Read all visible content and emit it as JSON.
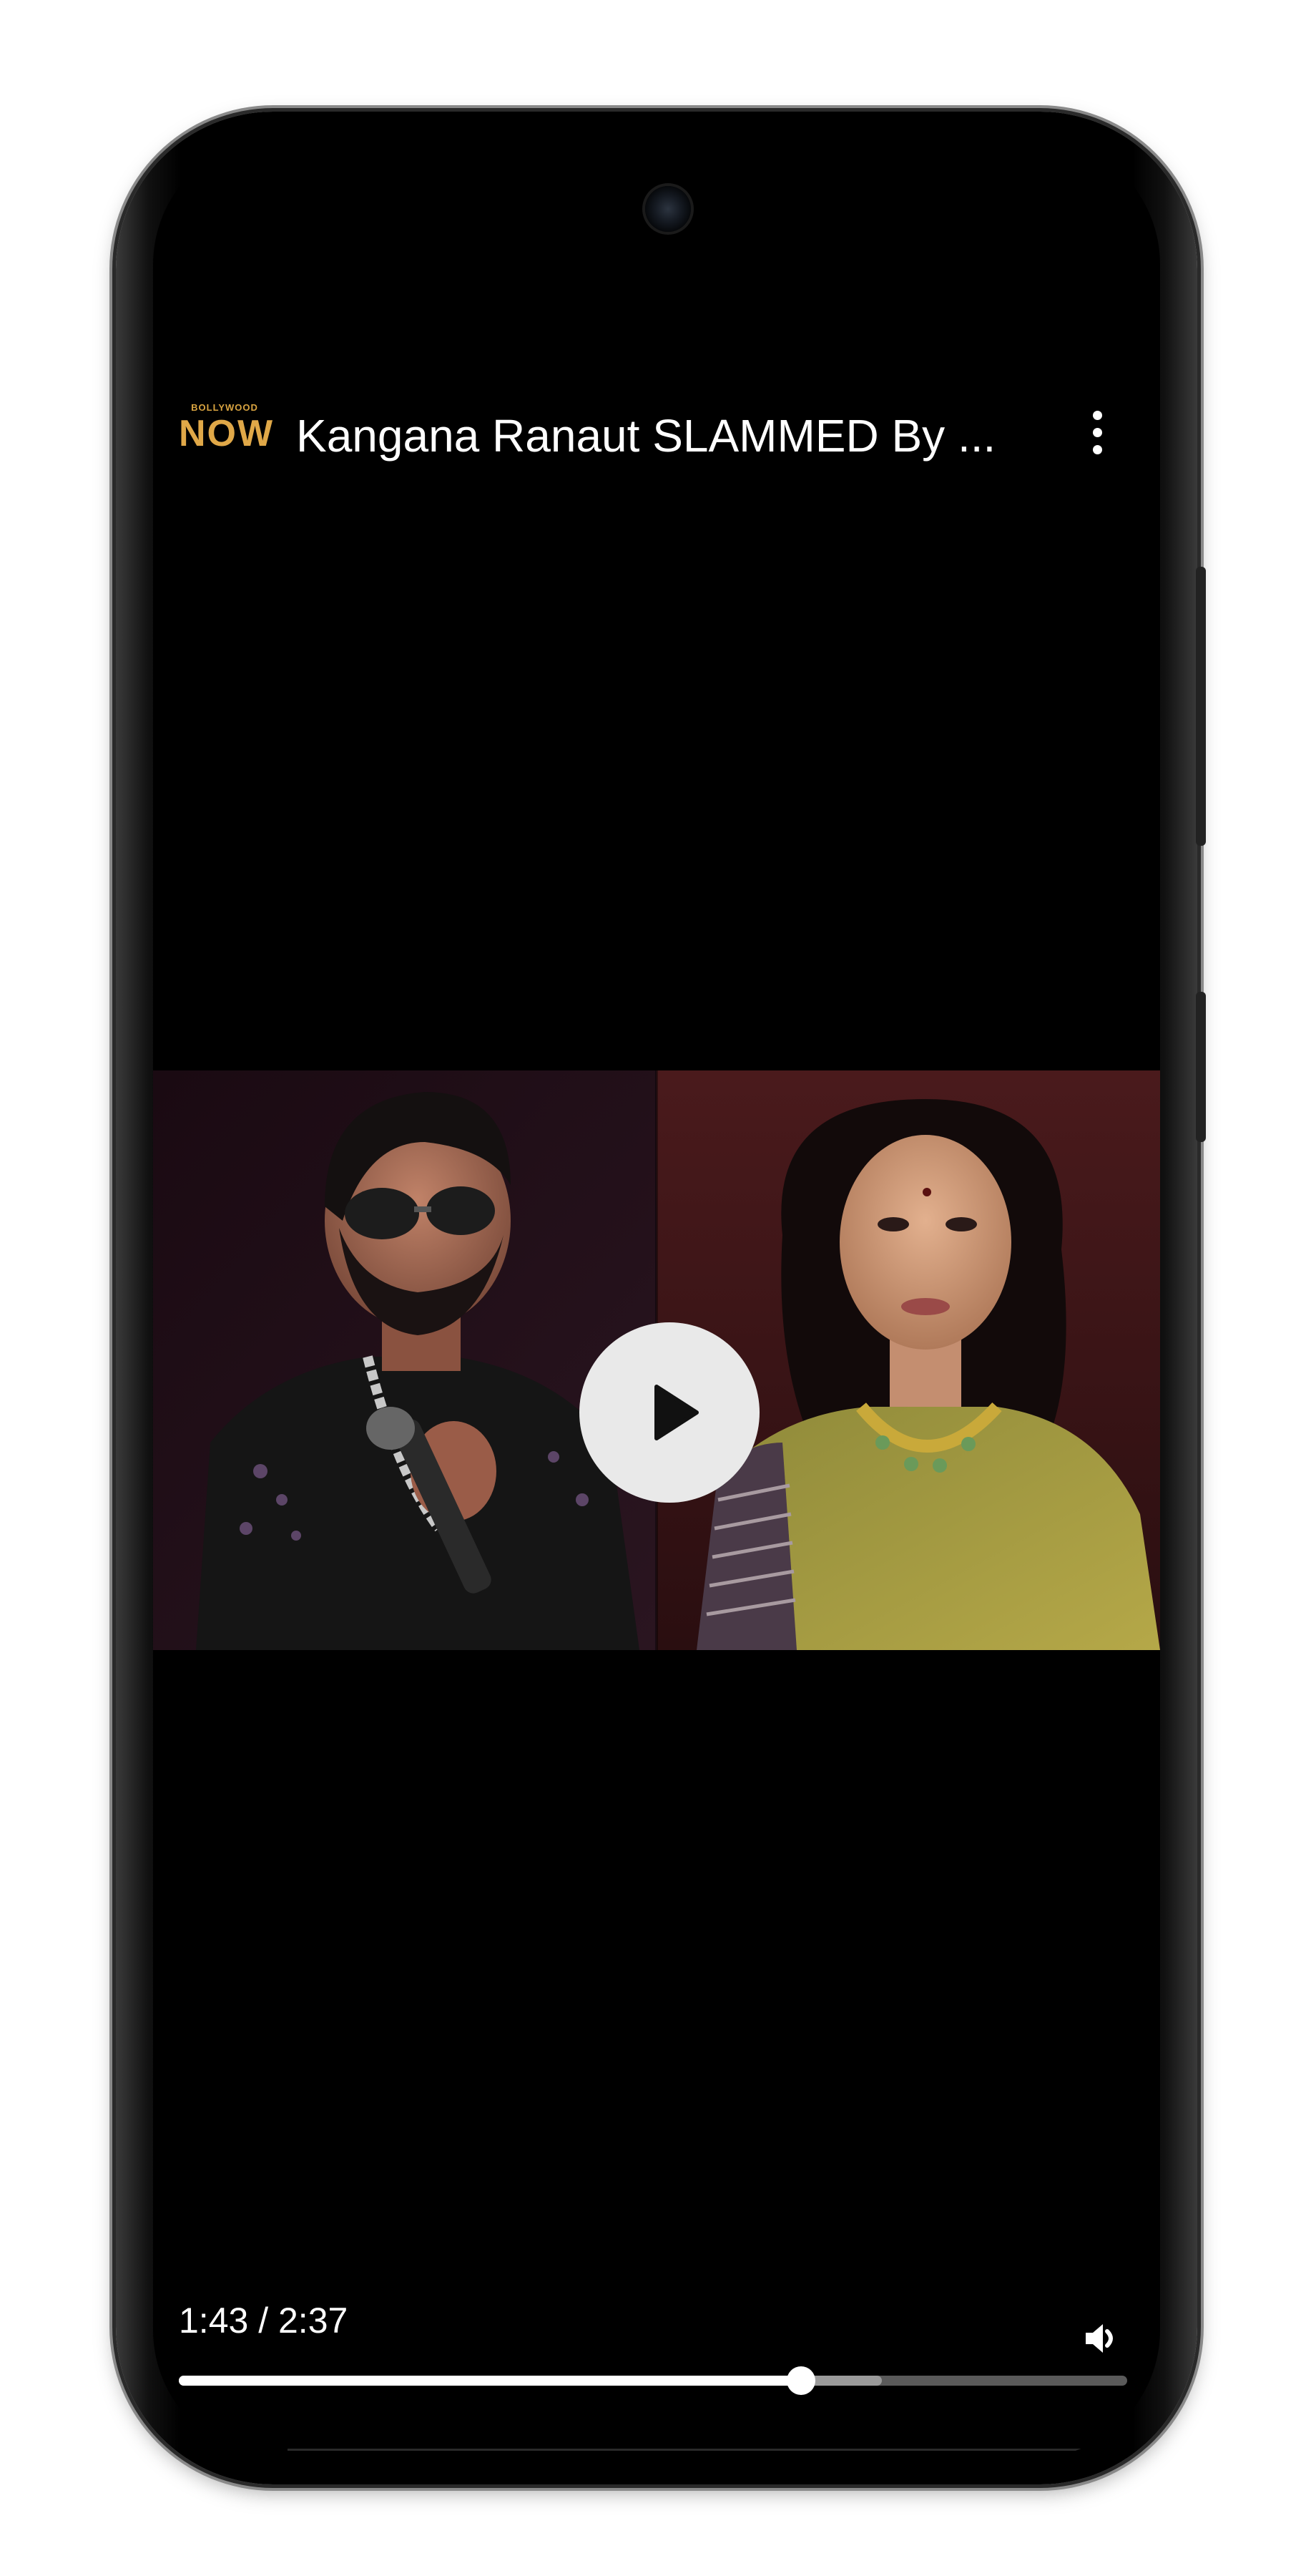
{
  "video": {
    "channel_logo_top": "BOLLYWOOD",
    "channel_logo_main": "NOW",
    "title": "Kangana Ranaut SLAMMED By ...",
    "more_icon": "more-vert-icon",
    "play_icon": "play-icon",
    "volume_icon": "volume-icon"
  },
  "playback": {
    "time_display": "1:43 / 2:37",
    "progress_fraction": 0.656,
    "buffered_fraction": 0.741
  },
  "colors": {
    "background": "#000000",
    "logo_gold": "#e0a848",
    "progress_fill": "#ffffff",
    "progress_buffer": "#9a9a9a",
    "progress_track": "#5a5a5a"
  }
}
